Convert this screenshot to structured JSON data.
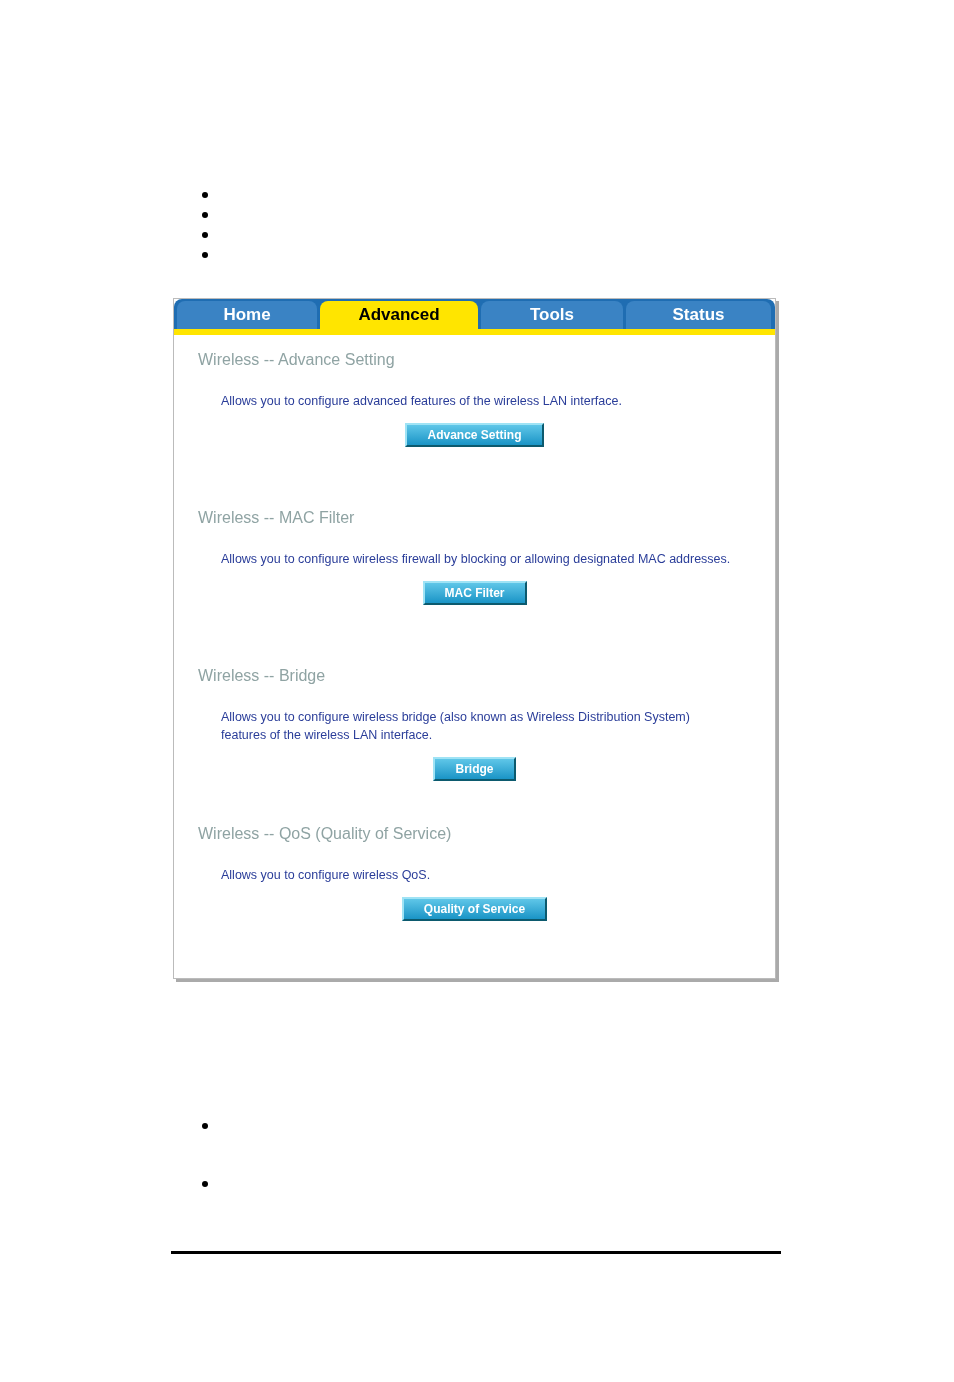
{
  "tabs": [
    {
      "label": "Home",
      "selected": false
    },
    {
      "label": "Advanced",
      "selected": true
    },
    {
      "label": "Tools",
      "selected": false
    },
    {
      "label": "Status",
      "selected": false
    }
  ],
  "sections": [
    {
      "title": "Wireless -- Advance Setting",
      "description": "Allows you to configure advanced features of the wireless LAN interface.",
      "button": "Advance Setting"
    },
    {
      "title": "Wireless -- MAC Filter",
      "description": "Allows you to configure wireless firewall by blocking or allowing designated MAC addresses.",
      "button": "MAC Filter"
    },
    {
      "title": "Wireless -- Bridge",
      "description": "Allows you to configure wireless bridge (also known as Wireless Distribution System) features of the wireless LAN interface.",
      "button": "Bridge"
    },
    {
      "title": "Wireless -- QoS (Quality of Service)",
      "description": "Allows you to configure wireless QoS.",
      "button": "Quality of Service"
    }
  ]
}
